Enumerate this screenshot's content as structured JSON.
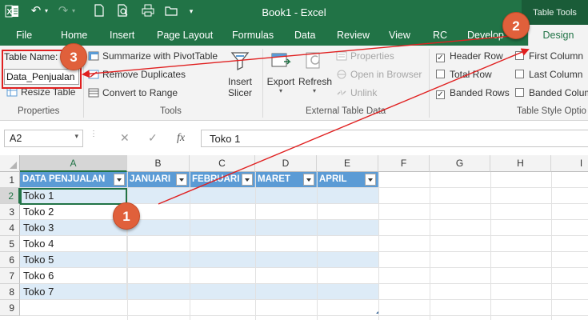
{
  "window": {
    "title": "Book1 - Excel",
    "context_header": "Table Tools"
  },
  "tabs": [
    "File",
    "Home",
    "Insert",
    "Page Layout",
    "Formulas",
    "Data",
    "Review",
    "View",
    "RC",
    "Develop",
    "Design"
  ],
  "ribbon": {
    "properties": {
      "table_name_label": "Table Name:",
      "table_name_value": "Data_Penjualan",
      "resize_table": "Resize Table",
      "group_label": "Properties"
    },
    "tools": {
      "summarize": "Summarize with PivotTable",
      "remove_duplicates": "Remove Duplicates",
      "convert_to_range": "Convert to Range",
      "insert_slicer_line1": "Insert",
      "insert_slicer_line2": "Slicer",
      "group_label": "Tools"
    },
    "external": {
      "export": "Export",
      "refresh": "Refresh",
      "properties": "Properties",
      "open_in_browser": "Open in Browser",
      "unlink": "Unlink",
      "group_label": "External Table Data"
    },
    "style_options": {
      "header_row": {
        "label": "Header Row",
        "checked": true
      },
      "total_row": {
        "label": "Total Row",
        "checked": false
      },
      "banded_rows": {
        "label": "Banded Rows",
        "checked": true
      },
      "first_column": {
        "label": "First Column",
        "checked": false
      },
      "last_column": {
        "label": "Last Column",
        "checked": false
      },
      "banded_columns": {
        "label": "Banded Colum",
        "checked": false
      },
      "group_label": "Table Style Optio"
    }
  },
  "formula_bar": {
    "name_box": "A2",
    "fx": "fx",
    "content": "Toko 1"
  },
  "sheet": {
    "columns": [
      "A",
      "B",
      "C",
      "D",
      "E",
      "F",
      "G",
      "H",
      "I"
    ],
    "rows": [
      "1",
      "2",
      "3",
      "4",
      "5",
      "6",
      "7",
      "8",
      "9"
    ],
    "table_headers": [
      "DATA PENJUALAN",
      "JANUARI",
      "FEBRUARI",
      "MARET",
      "APRIL"
    ],
    "column_a_values": [
      "Toko 1",
      "Toko 2",
      "Toko 3",
      "Toko 4",
      "Toko 5",
      "Toko 6",
      "Toko 7"
    ],
    "active_cell": "A2"
  },
  "annotations": {
    "badge1": "1",
    "badge2": "2",
    "badge3": "3",
    "color": "#e0603b",
    "arrow_color": "#e02020"
  },
  "colors": {
    "excel_green": "#217346",
    "table_header": "#5b9bd5",
    "table_band": "#ddebf7"
  }
}
